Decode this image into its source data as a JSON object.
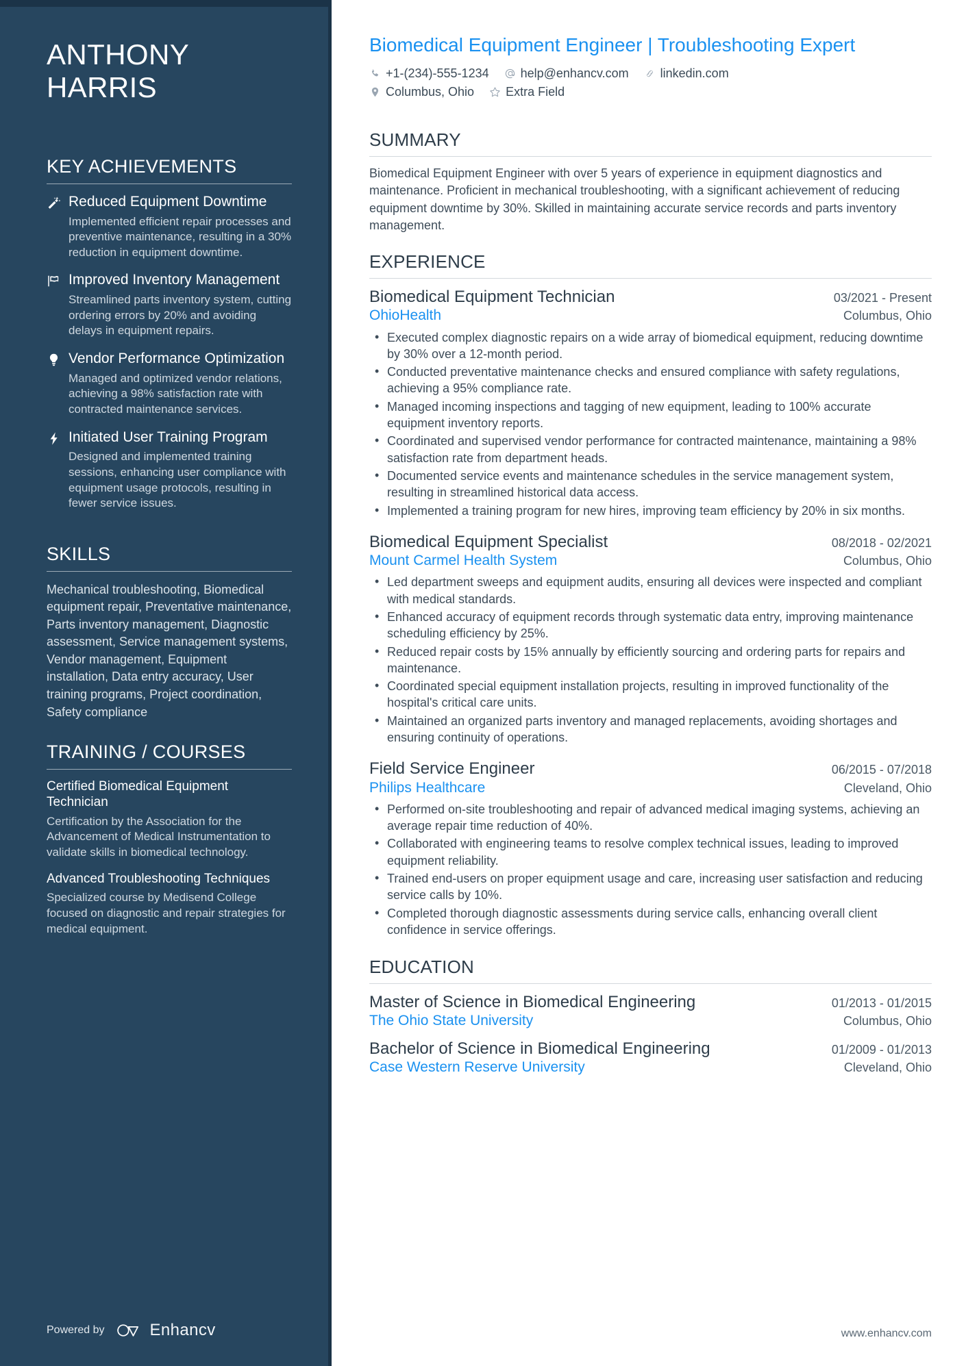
{
  "sidebar": {
    "name_first": "ANTHONY",
    "name_last": "HARRIS",
    "achievements_heading": "KEY ACHIEVEMENTS",
    "achievements": [
      {
        "icon": "magic-wand-icon",
        "title": "Reduced Equipment Downtime",
        "description": "Implemented efficient repair processes and preventive maintenance, resulting in a 30% reduction in equipment downtime."
      },
      {
        "icon": "flag-icon",
        "title": "Improved Inventory Management",
        "description": "Streamlined parts inventory system, cutting ordering errors by 20% and avoiding delays in equipment repairs."
      },
      {
        "icon": "lightbulb-icon",
        "title": "Vendor Performance Optimization",
        "description": "Managed and optimized vendor relations, achieving a 98% satisfaction rate with contracted maintenance services."
      },
      {
        "icon": "lightning-bolt-icon",
        "title": "Initiated User Training Program",
        "description": "Designed and implemented training sessions, enhancing user compliance with equipment usage protocols, resulting in fewer service issues."
      }
    ],
    "skills_heading": "SKILLS",
    "skills_text": "Mechanical troubleshooting, Biomedical equipment repair, Preventative maintenance, Parts inventory management, Diagnostic assessment, Service management systems, Vendor management, Equipment installation, Data entry accuracy, User training programs, Project coordination, Safety compliance",
    "training_heading": "TRAINING / COURSES",
    "courses": [
      {
        "title": "Certified Biomedical Equipment Technician",
        "description": "Certification by the Association for the Advancement of Medical Instrumentation to validate skills in biomedical technology."
      },
      {
        "title": "Advanced Troubleshooting Techniques",
        "description": "Specialized course by Medisend College focused on diagnostic and repair strategies for medical equipment."
      }
    ],
    "footer": {
      "powered_by": "Powered by",
      "brand": "Enhancv"
    }
  },
  "main": {
    "headline": "Biomedical Equipment Engineer | Troubleshooting Expert",
    "contacts_row1": [
      {
        "icon": "phone-icon",
        "text": "+1-(234)-555-1234"
      },
      {
        "icon": "at-sign-icon",
        "text": "help@enhancv.com"
      },
      {
        "icon": "link-icon",
        "text": "linkedin.com"
      }
    ],
    "contacts_row2": [
      {
        "icon": "location-pin-icon",
        "text": "Columbus, Ohio"
      },
      {
        "icon": "star-icon",
        "text": "Extra Field"
      }
    ],
    "summary_heading": "SUMMARY",
    "summary_text": "Biomedical Equipment Engineer with over 5 years of experience in equipment diagnostics and maintenance. Proficient in mechanical troubleshooting, with a significant achievement of reducing equipment downtime by 30%. Skilled in maintaining accurate service records and parts inventory management.",
    "experience_heading": "EXPERIENCE",
    "jobs": [
      {
        "title": "Biomedical Equipment Technician",
        "dates": "03/2021 - Present",
        "organization": "OhioHealth",
        "location": "Columbus, Ohio",
        "bullets": [
          "Executed complex diagnostic repairs on a wide array of biomedical equipment, reducing downtime by 30% over a 12-month period.",
          "Conducted preventative maintenance checks and ensured compliance with safety regulations, achieving a 95% compliance rate.",
          "Managed incoming inspections and tagging of new equipment, leading to 100% accurate equipment inventory reports.",
          "Coordinated and supervised vendor performance for contracted maintenance, maintaining a 98% satisfaction rate from department heads.",
          "Documented service events and maintenance schedules in the service management system, resulting in streamlined historical data access.",
          "Implemented a training program for new hires, improving team efficiency by 20% in six months."
        ]
      },
      {
        "title": "Biomedical Equipment Specialist",
        "dates": "08/2018 - 02/2021",
        "organization": "Mount Carmel Health System",
        "location": "Columbus, Ohio",
        "bullets": [
          "Led department sweeps and equipment audits, ensuring all devices were inspected and compliant with medical standards.",
          "Enhanced accuracy of equipment records through systematic data entry, improving maintenance scheduling efficiency by 25%.",
          "Reduced repair costs by 15% annually by efficiently sourcing and ordering parts for repairs and maintenance.",
          "Coordinated special equipment installation projects, resulting in improved functionality of the hospital's critical care units.",
          "Maintained an organized parts inventory and managed replacements, avoiding shortages and ensuring continuity of operations."
        ]
      },
      {
        "title": "Field Service Engineer",
        "dates": "06/2015 - 07/2018",
        "organization": "Philips Healthcare",
        "location": "Cleveland, Ohio",
        "bullets": [
          "Performed on-site troubleshooting and repair of advanced medical imaging systems, achieving an average repair time reduction of 40%.",
          "Collaborated with engineering teams to resolve complex technical issues, leading to improved equipment reliability.",
          "Trained end-users on proper equipment usage and care, increasing user satisfaction and reducing service calls by 10%.",
          "Completed thorough diagnostic assessments during service calls, enhancing overall client confidence in service offerings."
        ]
      }
    ],
    "education_heading": "EDUCATION",
    "education": [
      {
        "degree": "Master of Science in Biomedical Engineering",
        "dates": "01/2013 - 01/2015",
        "school": "The Ohio State University",
        "location": "Columbus, Ohio"
      },
      {
        "degree": "Bachelor of Science in Biomedical Engineering",
        "dates": "01/2009 - 01/2013",
        "school": "Case Western Reserve University",
        "location": "Cleveland, Ohio"
      }
    ],
    "footer_url": "www.enhancv.com"
  }
}
